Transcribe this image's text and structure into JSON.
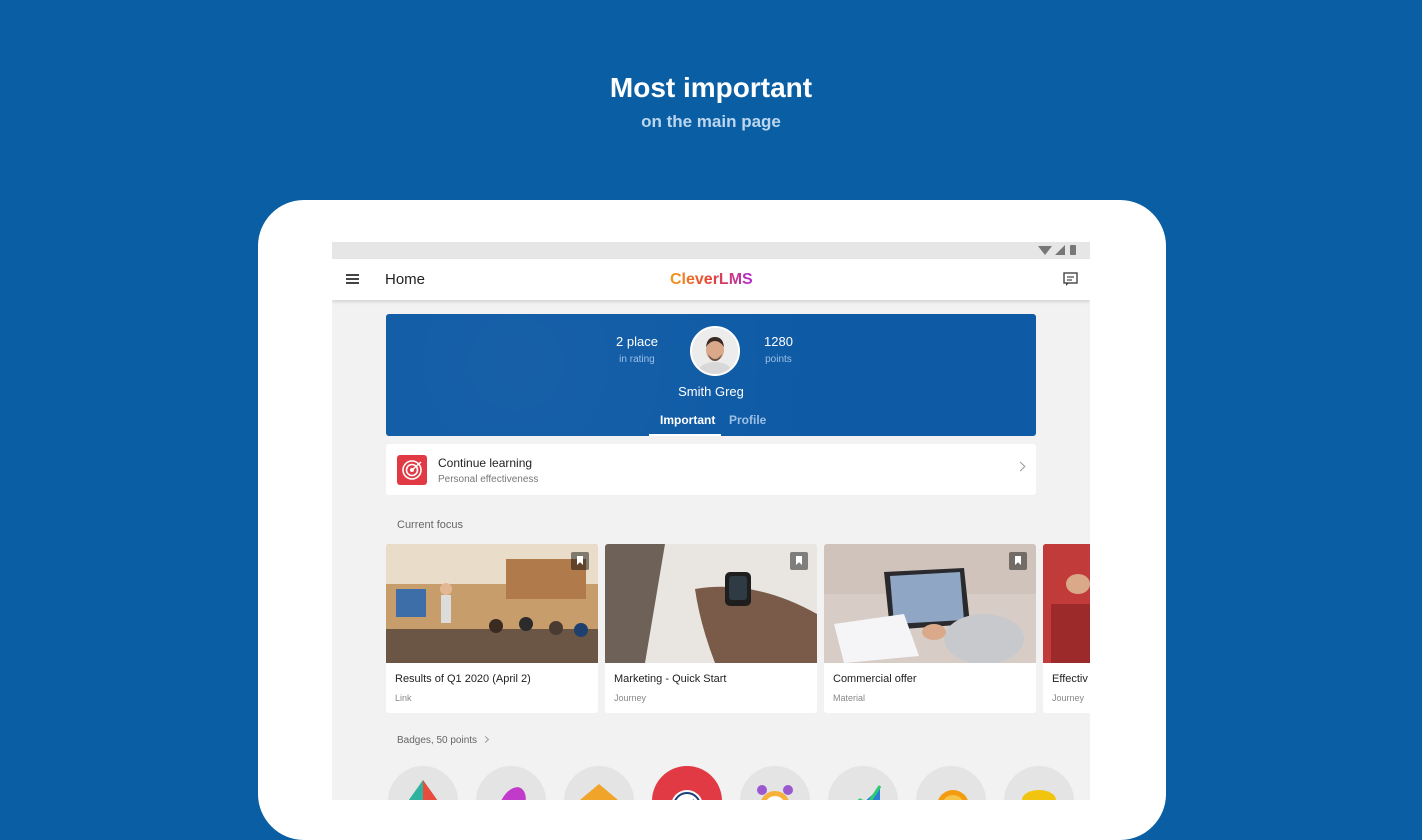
{
  "promo": {
    "title": "Most important",
    "subtitle": "on the main page"
  },
  "appbar": {
    "title": "Home",
    "logo": "CleverLMS"
  },
  "profile": {
    "rank_value": "2 place",
    "rank_label": "in rating",
    "points_value": "1280",
    "points_label": "points",
    "name": "Smith Greg",
    "tabs": [
      {
        "label": "Important",
        "active": true
      },
      {
        "label": "Profile",
        "active": false
      }
    ]
  },
  "continue": {
    "title": "Continue learning",
    "subtitle": "Personal effectiveness"
  },
  "current_focus": {
    "label": "Current focus",
    "cards": [
      {
        "title": "Results of Q1 2020 (April 2)",
        "type": "Link"
      },
      {
        "title": "Marketing - Quick Start",
        "type": "Journey"
      },
      {
        "title": "Commercial offer",
        "type": "Material"
      },
      {
        "title": "Effectiv",
        "type": "Journey"
      }
    ]
  },
  "badges": {
    "label": "Badges, 50 points"
  },
  "colors": {
    "background": "#0a5fa4",
    "profile_card": "#0e5aa5",
    "continue_icon": "#e23a44"
  }
}
